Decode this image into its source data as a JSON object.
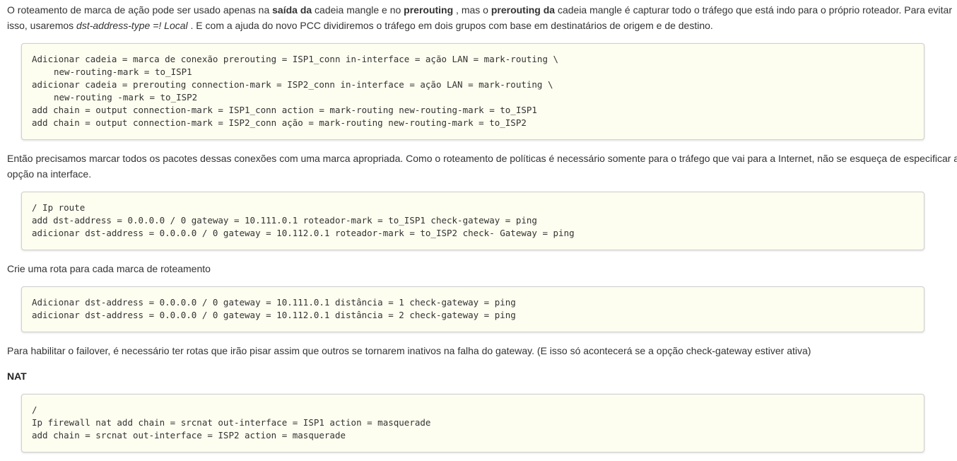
{
  "p1": {
    "line1_a": "O roteamento de marca de ação pode ser usado apenas na ",
    "line1_b": "saída da",
    "line1_c": " cadeia mangle e no ",
    "line1_d": "prerouting",
    "line1_e": " , mas o ",
    "line1_f": "prerouting da",
    "line1_g": " cadeia mangle é capturar todo o tráfego que está indo para o próprio roteador. Para evitar",
    "line2_a": "isso, usaremos ",
    "line2_b": "dst-address-type =! Local",
    "line2_c": " . E com a ajuda do novo PCC dividiremos o tráfego em dois grupos com base em destinatários de origem e de destino."
  },
  "code1": {
    "l1": "Adicionar cadeia = marca de conexão prerouting = ISP1_conn in-interface = ação LAN = mark-routing \\",
    "l2": "new-routing-mark = to_ISP1",
    "l3": "adicionar cadeia = prerouting connection-mark = ISP2_conn in-interface = ação LAN = mark-routing \\",
    "l4": "new-routing -mark = to_ISP2",
    "l5": "add chain = output connection-mark = ISP1_conn action = mark-routing new-routing-mark = to_ISP1",
    "l6": "add chain = output connection-mark = ISP2_conn ação = mark-routing new-routing-mark = to_ISP2"
  },
  "p2": {
    "line1": "Então precisamos marcar todos os pacotes dessas conexões com uma marca apropriada. Como o roteamento de políticas é necessário somente para o tráfego que vai para a Internet, não se esqueça de especificar a",
    "line2": "opção na interface."
  },
  "code2": {
    "l1": "/ Ip route",
    "l2": "add dst-address = 0.0.0.0 / 0 gateway = 10.111.0.1 roteador-mark = to_ISP1 check-gateway = ping",
    "l3": "adicionar dst-address = 0.0.0.0 / 0 gateway = 10.112.0.1 roteador-mark = to_ISP2 check- Gateway = ping"
  },
  "p3": {
    "line1": "Crie uma rota para cada marca de roteamento"
  },
  "code3": {
    "l1": "Adicionar dst-address = 0.0.0.0 / 0 gateway = 10.111.0.1 distância = 1 check-gateway = ping",
    "l2": "adicionar dst-address = 0.0.0.0 / 0 gateway = 10.112.0.1 distância = 2 check-gateway = ping"
  },
  "p4": {
    "line1": "Para habilitar o failover, é necessário ter rotas que irão pisar assim que outros se tornarem inativos na falha do gateway. (E isso só acontecerá se a opção check-gateway estiver ativa)"
  },
  "nat_heading": "NAT",
  "code4": {
    "l1": "/",
    "l2": "Ip firewall nat add chain = srcnat out-interface = ISP1 action = masquerade",
    "l3": "add chain = srcnat out-interface = ISP2 action = masquerade"
  }
}
